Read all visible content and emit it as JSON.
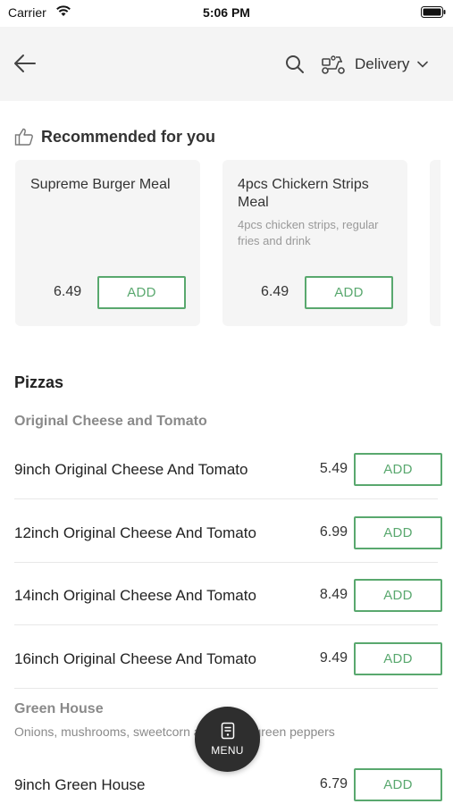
{
  "status_bar": {
    "carrier": "Carrier",
    "time": "5:06 PM"
  },
  "header": {
    "delivery_label": "Delivery"
  },
  "recommended": {
    "title": "Recommended for you",
    "items": [
      {
        "name": "Supreme Burger Meal",
        "description": "",
        "price": "6.49",
        "add_label": "ADD"
      },
      {
        "name": "4pcs Chickern Strips Meal",
        "description": "4pcs chicken strips, regular fries and drink",
        "price": "6.49",
        "add_label": "ADD"
      }
    ]
  },
  "pizzas": {
    "title": "Pizzas",
    "groups": [
      {
        "name": "Original Cheese and Tomato",
        "description": "",
        "items": [
          {
            "name": "9inch Original Cheese And Tomato",
            "price": "5.49",
            "add_label": "ADD"
          },
          {
            "name": "12inch Original Cheese And Tomato",
            "price": "6.99",
            "add_label": "ADD"
          },
          {
            "name": "14inch Original Cheese And Tomato",
            "price": "8.49",
            "add_label": "ADD"
          },
          {
            "name": "16inch Original Cheese And Tomato",
            "price": "9.49",
            "add_label": "ADD"
          }
        ]
      },
      {
        "name": "Green House",
        "description": "Onions, mushrooms, sweetcorn and sweet green peppers",
        "items": [
          {
            "name": "9inch Green House",
            "price": "6.79",
            "add_label": "ADD"
          }
        ]
      }
    ]
  },
  "menu_button": {
    "label": "MENU"
  },
  "icons": [
    "back-arrow-icon",
    "search-icon",
    "scooter-icon",
    "chevron-down-icon",
    "thumbs-up-icon",
    "menu-book-icon",
    "wifi-icon",
    "battery-icon"
  ],
  "colors": {
    "accent_green": "#59a86e",
    "header_bg": "#f4f4f4",
    "card_bg": "#f5f5f5",
    "fab_bg": "#2e2e2e"
  }
}
